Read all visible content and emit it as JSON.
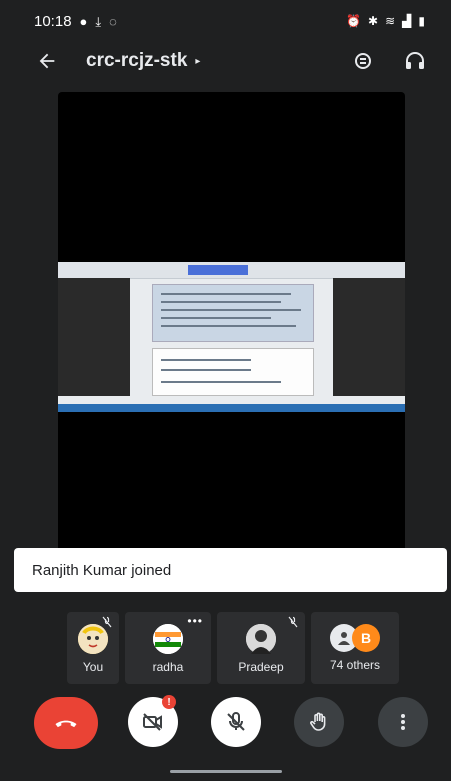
{
  "status_bar": {
    "time": "10:18",
    "left_icons": [
      "whatsapp-icon",
      "download-icon",
      "sync-icon"
    ],
    "right_icons": [
      "alarm-icon",
      "bluetooth-icon",
      "wifi-icon",
      "signal-icon",
      "battery-icon"
    ]
  },
  "app_bar": {
    "title": "crc-rcjz-stk",
    "caret": "▸"
  },
  "toast": {
    "message": "Ranjith Kumar joined"
  },
  "participants": [
    {
      "name": "You",
      "muted": true
    },
    {
      "name": "radha",
      "muted": false,
      "more": "•••"
    },
    {
      "name": "Pradeep",
      "muted": true
    },
    {
      "name": "74 others",
      "avatar_letters": [
        "",
        "B"
      ]
    }
  ],
  "controls": {
    "camera_badge": "!"
  },
  "colors": {
    "end_call": "#ea4335",
    "background": "#1f2021",
    "tile": "#2d2e30",
    "others_b_avatar": "#ff8a1a"
  }
}
